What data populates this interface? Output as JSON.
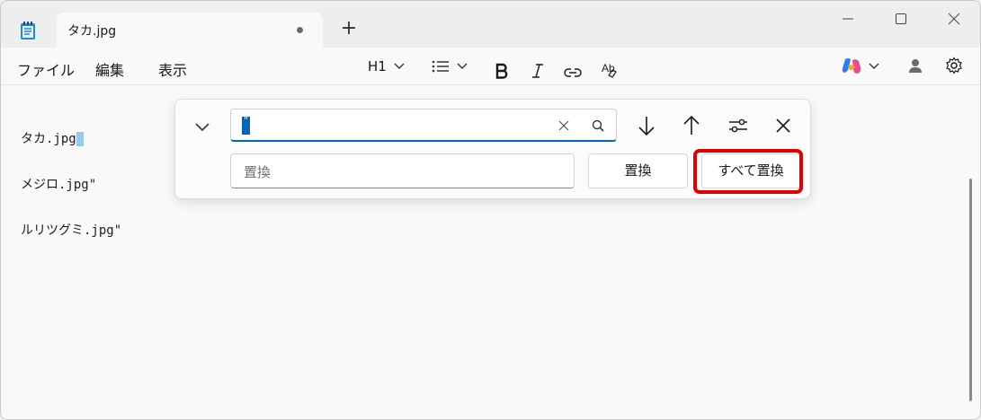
{
  "tab": {
    "title": "タカ.jpg",
    "new_tab_symbol": "+"
  },
  "menu": {
    "file": "ファイル",
    "edit": "編集",
    "view": "表示"
  },
  "toolbar": {
    "heading": "H1"
  },
  "editor": {
    "lines": [
      "タカ.jpg",
      "メジロ.jpg\"",
      "ルリツグミ.jpg\""
    ]
  },
  "find": {
    "search_value": "\"",
    "replace_placeholder": "置換",
    "replace_button": "置換",
    "replace_all_button": "すべて置換"
  },
  "colors": {
    "accent": "#0067c0",
    "highlight": "#e00000"
  }
}
